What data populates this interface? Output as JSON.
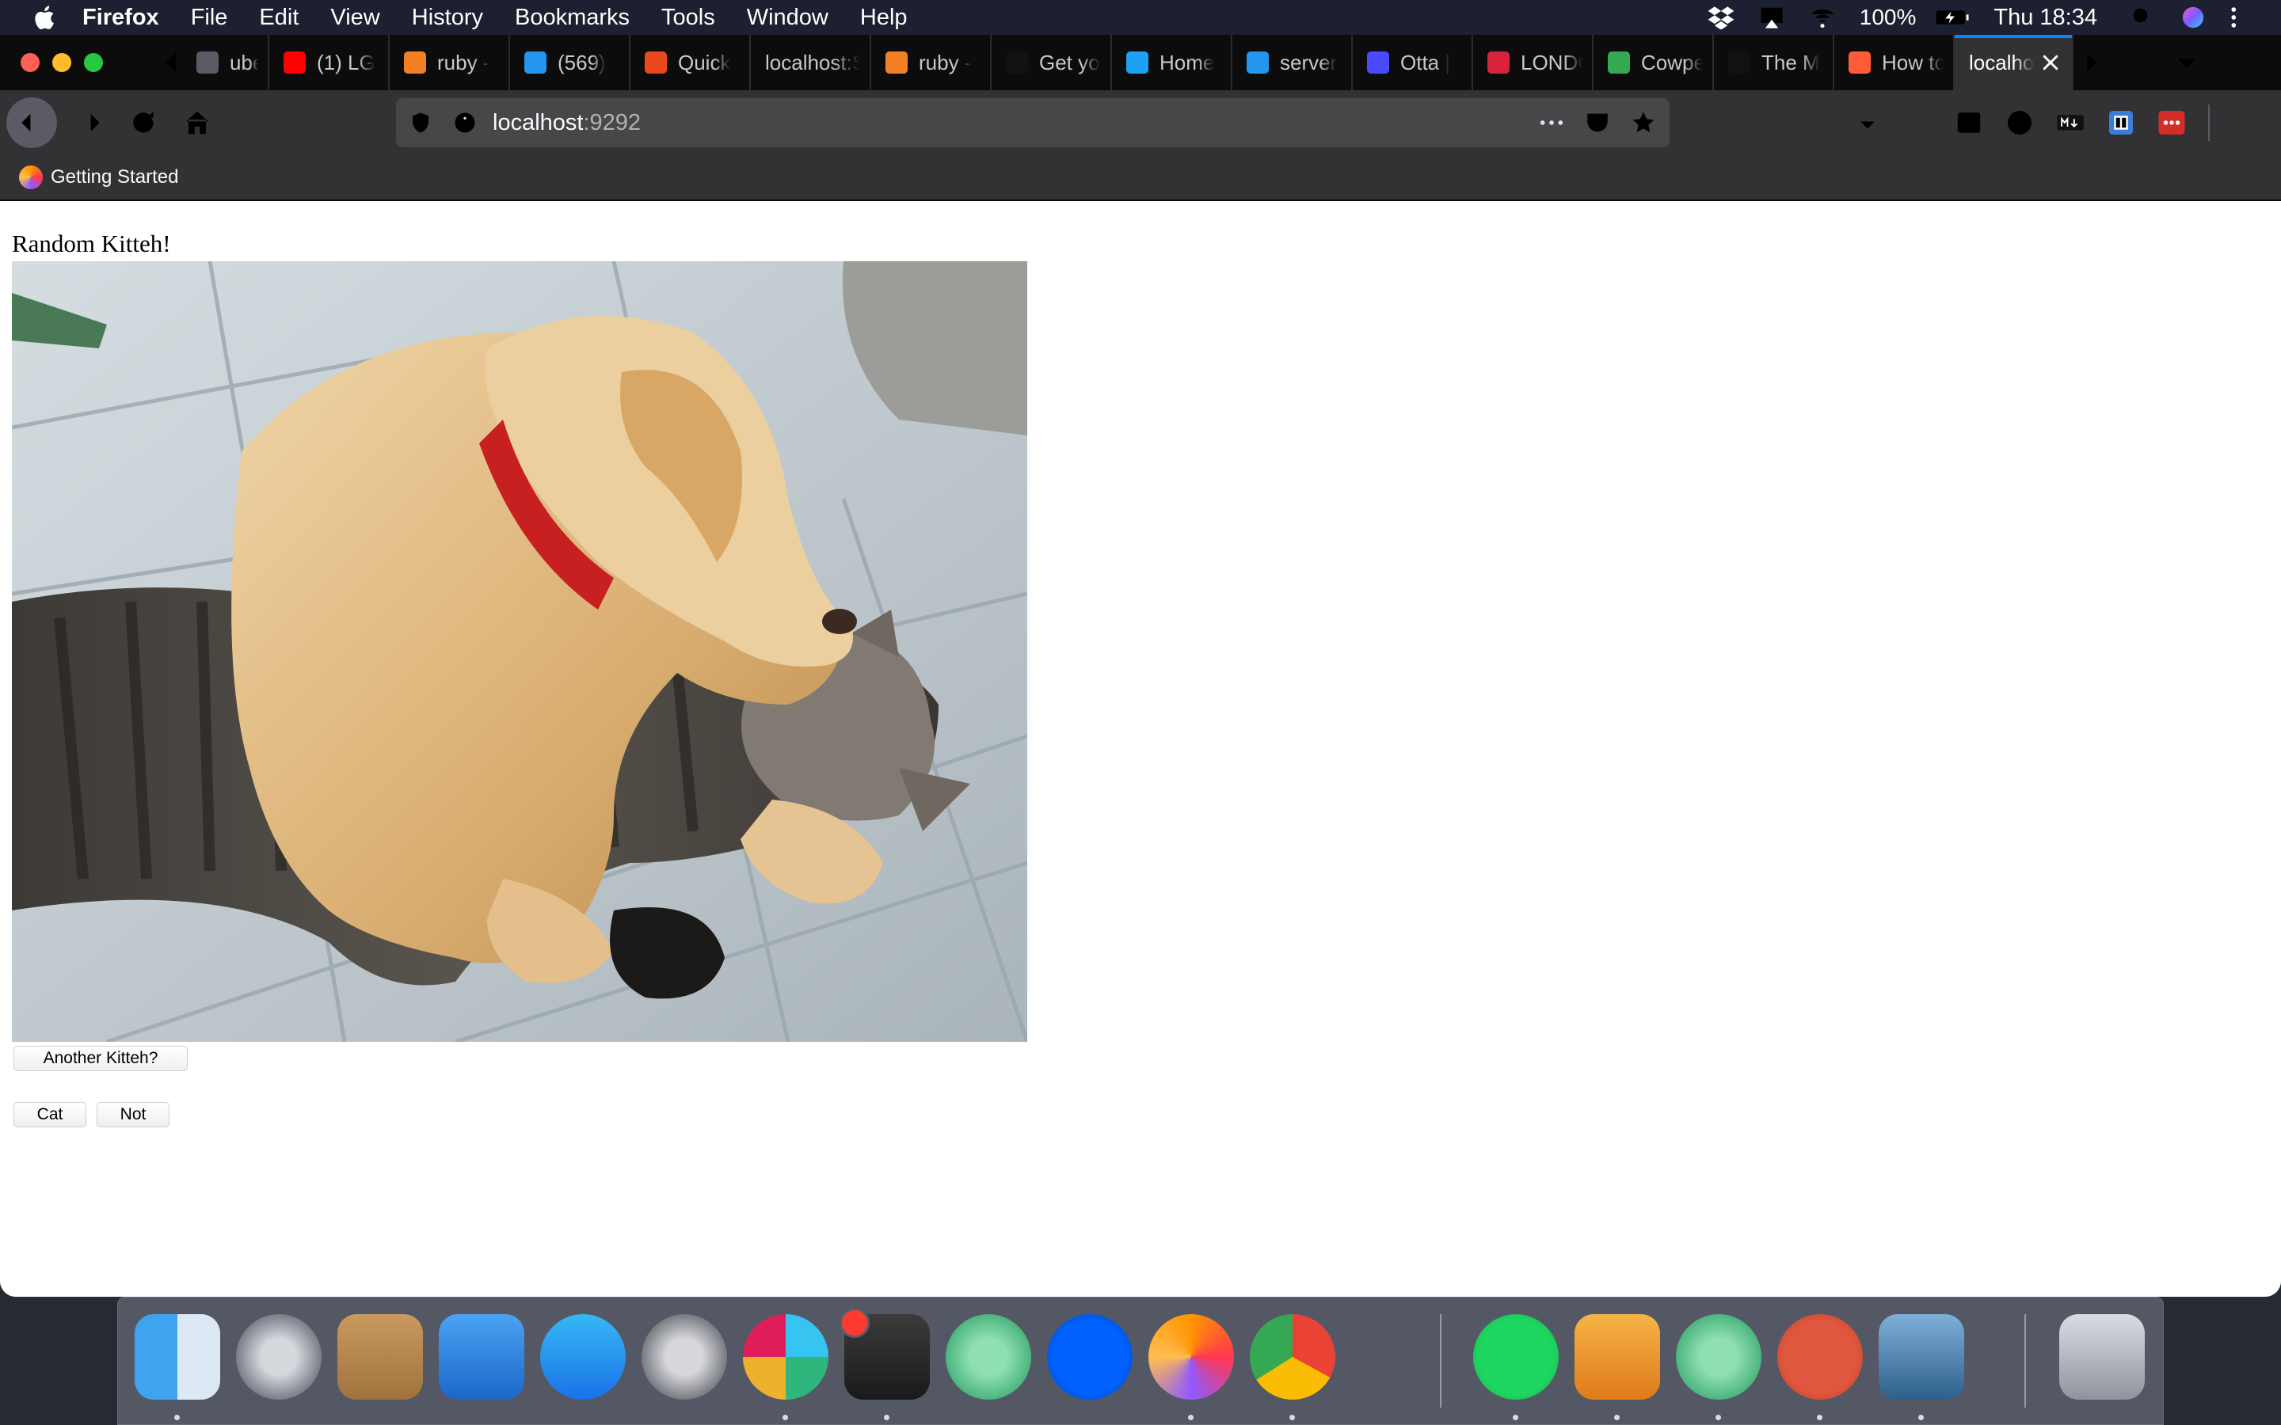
{
  "menubar": {
    "app_name": "Firefox",
    "items": [
      "File",
      "Edit",
      "View",
      "History",
      "Bookmarks",
      "Tools",
      "Window",
      "Help"
    ],
    "battery": "100%",
    "clock": "Thu 18:34"
  },
  "tabs": [
    {
      "label": "ubert",
      "favicon": "page-icon",
      "color": "#5b5b66"
    },
    {
      "label": "(1) LG",
      "favicon": "youtube-icon",
      "color": "#ff0000"
    },
    {
      "label": "ruby -",
      "favicon": "stackoverflow-icon",
      "color": "#f48024"
    },
    {
      "label": "(569)",
      "favicon": "docker-icon",
      "color": "#2496ed"
    },
    {
      "label": "Quick",
      "favicon": "chevron-icon",
      "color": "#e8491d"
    },
    {
      "label": "localhost:S",
      "favicon": "none",
      "color": "#0c0c0d"
    },
    {
      "label": "ruby -",
      "favicon": "stackoverflow-icon",
      "color": "#f48024"
    },
    {
      "label": "Get yo",
      "favicon": "github-icon",
      "color": "#111111"
    },
    {
      "label": "Home",
      "favicon": "twitter-icon",
      "color": "#1da1f2"
    },
    {
      "label": "server",
      "favicon": "docker-icon",
      "color": "#2496ed"
    },
    {
      "label": "Otta |",
      "favicon": "otta-icon",
      "color": "#4a4aff"
    },
    {
      "label": "LONDO",
      "favicon": "tech-icon",
      "color": "#d9233c"
    },
    {
      "label": "Cowpe",
      "favicon": "maps-icon",
      "color": "#34a853"
    },
    {
      "label": "The M",
      "favicon": "w-icon",
      "color": "#111111"
    },
    {
      "label": "How to",
      "favicon": "hubspot-icon",
      "color": "#ff5c35"
    },
    {
      "label": "localho",
      "favicon": "none",
      "color": "#323234",
      "active": true
    }
  ],
  "url": {
    "host": "localhost",
    "port": ":9292"
  },
  "bookmarks": {
    "getting_started": "Getting Started"
  },
  "page": {
    "heading": "Random Kitteh!",
    "another_button": "Another Kitteh?",
    "cat_button": "Cat",
    "not_button": "Not"
  },
  "dock": [
    "finder-icon",
    "launchpad-icon",
    "contacts-icon",
    "keynote-icon",
    "app-store-icon",
    "system-preferences-icon",
    "slack-icon",
    "terminal-icon",
    "atom-icon",
    "dropbox-icon",
    "firefox-icon",
    "chrome-icon",
    "spotify-icon",
    "pages-icon",
    "atom-icon",
    "remote-desktop-icon",
    "preview-icon",
    "trash-icon"
  ]
}
